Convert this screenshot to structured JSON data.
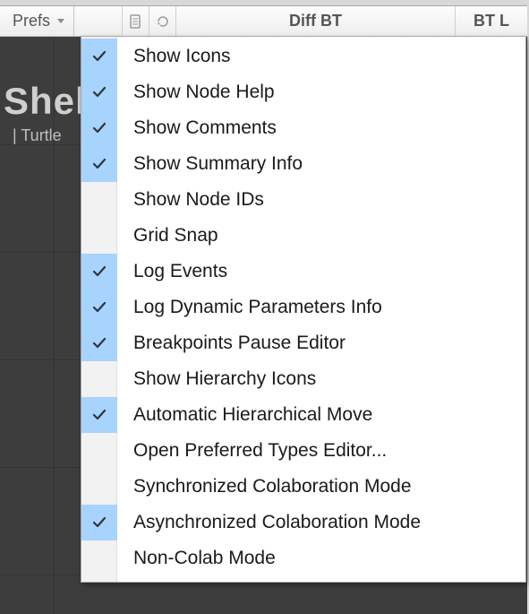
{
  "toolbar": {
    "prefs_label": "Prefs",
    "mid_label": "Diff BT",
    "right_label": "BT L"
  },
  "background": {
    "title_fragment": "Shel",
    "subtitle_fragment": "| Turtle"
  },
  "menu": {
    "items": [
      {
        "label": "Show Icons",
        "checked": true
      },
      {
        "label": "Show Node Help",
        "checked": true
      },
      {
        "label": "Show Comments",
        "checked": true
      },
      {
        "label": "Show Summary Info",
        "checked": true
      },
      {
        "label": "Show Node IDs",
        "checked": false
      },
      {
        "label": "Grid Snap",
        "checked": false
      },
      {
        "label": "Log Events",
        "checked": true
      },
      {
        "label": "Log Dynamic Parameters Info",
        "checked": true
      },
      {
        "label": "Breakpoints Pause Editor",
        "checked": true
      },
      {
        "label": "Show Hierarchy Icons",
        "checked": false
      },
      {
        "label": "Automatic Hierarchical Move",
        "checked": true
      },
      {
        "label": "Open Preferred Types Editor...",
        "checked": false
      },
      {
        "label": "Synchronized Colaboration Mode",
        "checked": false
      },
      {
        "label": "Asynchronized Colaboration Mode",
        "checked": true
      },
      {
        "label": "Non-Colab Mode",
        "checked": false
      }
    ]
  }
}
